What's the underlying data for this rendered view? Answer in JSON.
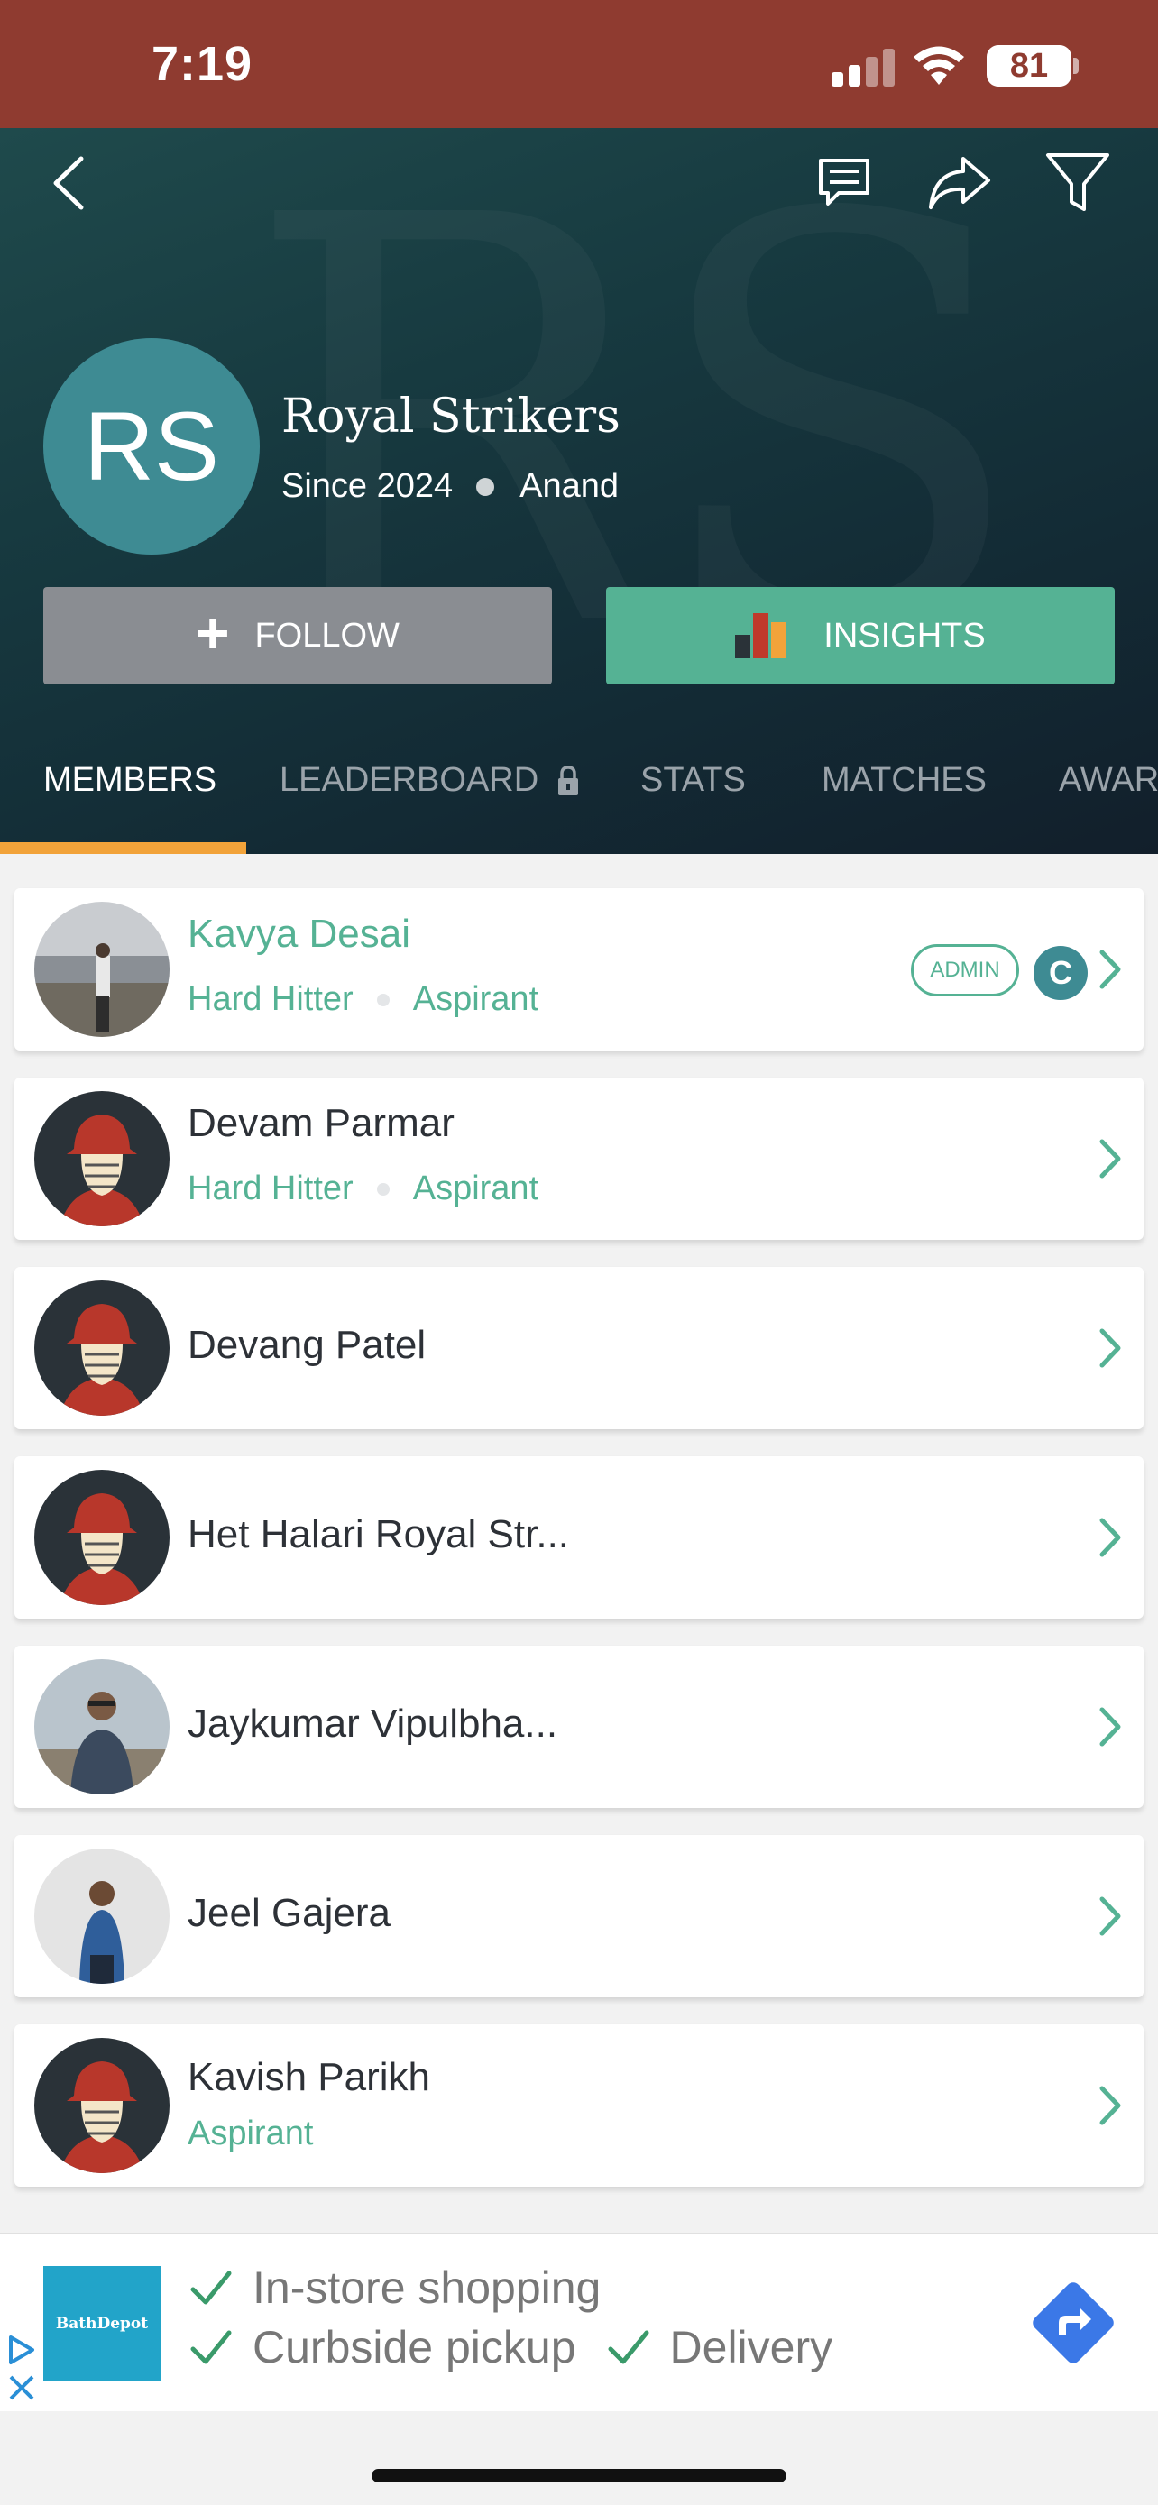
{
  "status_bar": {
    "time": "7:19",
    "battery": "81"
  },
  "header": {
    "team_initials": "RS",
    "team_name": "Royal Strikers",
    "since": "Since 2024",
    "city": "Anand",
    "follow_label": "FOLLOW",
    "insights_label": "INSIGHTS",
    "icons": [
      "back-icon",
      "chat-icon",
      "share-icon",
      "filter-icon"
    ]
  },
  "tabs": [
    {
      "label": "MEMBERS",
      "active": true
    },
    {
      "label": "LEADERBOARD",
      "locked": true
    },
    {
      "label": "STATS"
    },
    {
      "label": "MATCHES"
    },
    {
      "label": "AWAR"
    }
  ],
  "members": [
    {
      "name": "Kavya Desai",
      "role": "Hard Hitter",
      "level": "Aspirant",
      "admin_badge": "ADMIN",
      "captain_badge": "C"
    },
    {
      "name": "Devam Parmar",
      "role": "Hard Hitter",
      "level": "Aspirant"
    },
    {
      "name": "Devang Patel"
    },
    {
      "name": "Het Halari Royal Str..."
    },
    {
      "name": "Jaykumar Vipulbha..."
    },
    {
      "name": "Jeel Gajera"
    },
    {
      "name": "Kavish Parikh",
      "level": "Aspirant"
    }
  ],
  "ad": {
    "logo_text": "BathDepot",
    "line1": "In-store shopping",
    "line2a": "Curbside pickup",
    "line2b": "Delivery"
  },
  "colors": {
    "accent": "#55b294",
    "status_bar": "#8f3b30",
    "tab_indicator": "#f2a33a",
    "avatar_bg": "#3e8b93"
  }
}
